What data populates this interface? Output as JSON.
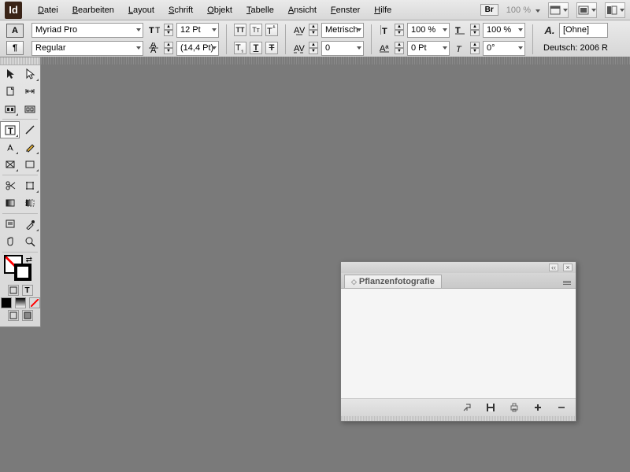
{
  "app": {
    "logo_text": "Id"
  },
  "menu": {
    "items": [
      {
        "pre": "",
        "u": "D",
        "post": "atei"
      },
      {
        "pre": "",
        "u": "B",
        "post": "earbeiten"
      },
      {
        "pre": "",
        "u": "L",
        "post": "ayout"
      },
      {
        "pre": "",
        "u": "S",
        "post": "chrift"
      },
      {
        "pre": "",
        "u": "O",
        "post": "bjekt"
      },
      {
        "pre": "",
        "u": "T",
        "post": "abelle"
      },
      {
        "pre": "",
        "u": "A",
        "post": "nsicht"
      },
      {
        "pre": "",
        "u": "F",
        "post": "enster"
      },
      {
        "pre": "",
        "u": "H",
        "post": "ilfe"
      }
    ],
    "bridge_label": "Br",
    "zoom_readout": "100 %"
  },
  "control": {
    "font_family": "Myriad Pro",
    "font_style": "Regular",
    "font_size": "12 Pt",
    "leading": "(14,4 Pt)",
    "kerning": "Metrisch",
    "tracking": "0",
    "vscale": "100 %",
    "hscale": "100 %",
    "baseline": "0 Pt",
    "skew": "0°",
    "char_style": "[Ohne]",
    "lang": "Deutsch: 2006 R"
  },
  "panel": {
    "tab_title": "Pflanzenfotografie"
  }
}
